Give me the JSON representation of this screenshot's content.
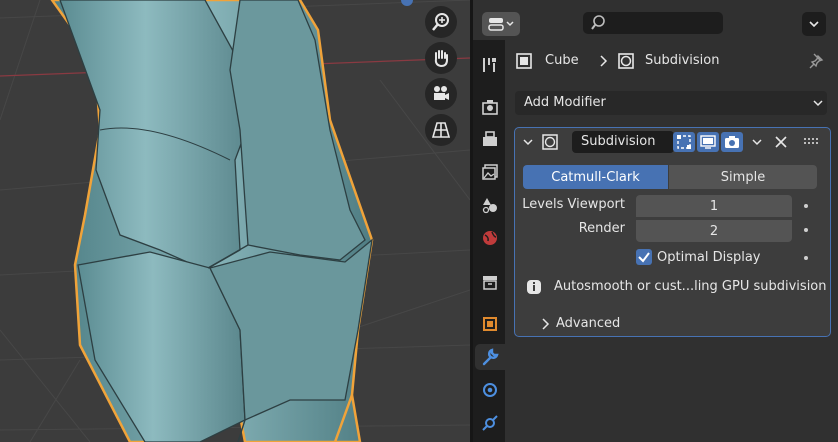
{
  "breadcrumb": {
    "object": "Cube",
    "modifier": "Subdivision"
  },
  "add_modifier": {
    "label": "Add Modifier"
  },
  "modifier": {
    "name": "Subdivision",
    "type_options": [
      "Catmull-Clark",
      "Simple"
    ],
    "selected_type": "Catmull-Clark",
    "levels_viewport": {
      "label": "Levels Viewport",
      "value": "1"
    },
    "render": {
      "label": "Render",
      "value": "2"
    },
    "optimal_display": {
      "label": "Optimal Display",
      "checked": true
    },
    "info": "Autosmooth or cust...ling GPU subdivision",
    "advanced_label": "Advanced"
  },
  "colors": {
    "accent": "#4772b3",
    "selection_outline": "#f0a33a",
    "mesh": "#6f9ea3",
    "background": "#3c3c3c"
  }
}
